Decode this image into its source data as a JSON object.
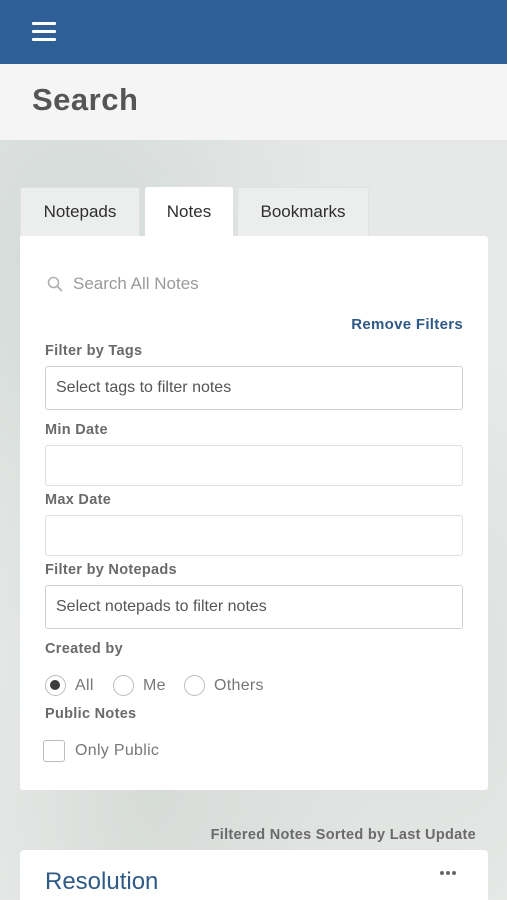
{
  "header": {
    "menu_icon": "hamburger-menu-icon",
    "title": "Search",
    "accent_color": "#2f5f97"
  },
  "tabs": [
    {
      "label": "Notepads",
      "active": false
    },
    {
      "label": "Notes",
      "active": true
    },
    {
      "label": "Bookmarks",
      "active": false
    }
  ],
  "search": {
    "placeholder": "Search All Notes",
    "value": "",
    "icon": "search-icon"
  },
  "filters": {
    "remove_label": "Remove Filters",
    "tags_label": "Filter by Tags",
    "tags_placeholder": "Select tags to filter notes",
    "min_date_label": "Min Date",
    "min_date_value": "",
    "max_date_label": "Max Date",
    "max_date_value": "",
    "notepads_label": "Filter by Notepads",
    "notepads_placeholder": "Select notepads to filter notes",
    "created_by_label": "Created by",
    "created_by_options": [
      {
        "label": "All",
        "checked": true
      },
      {
        "label": "Me",
        "checked": false
      },
      {
        "label": "Others",
        "checked": false
      }
    ],
    "public_label": "Public Notes",
    "only_public_label": "Only Public",
    "only_public_checked": false
  },
  "results": {
    "sort_label": "Filtered Notes Sorted by Last Update",
    "notes": [
      {
        "title": "Resolution",
        "menu_icon": "more-dots-icon"
      }
    ]
  }
}
